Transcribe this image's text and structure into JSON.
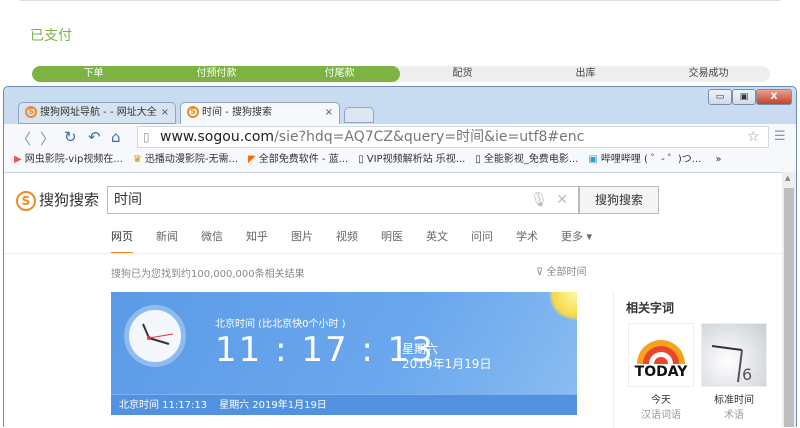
{
  "status": "已支付",
  "steps": [
    {
      "label": "下单",
      "done": true
    },
    {
      "label": "付预付款",
      "done": true
    },
    {
      "label": "付尾款",
      "done": true
    },
    {
      "label": "配货",
      "done": false
    },
    {
      "label": "出库",
      "done": false
    },
    {
      "label": "交易成功",
      "done": false
    }
  ],
  "window": {
    "minimize": "▭",
    "maximize": "▣",
    "close": "X"
  },
  "tabs": [
    {
      "title": "搜狗网址导航 - - 网址大全",
      "close": "×"
    },
    {
      "title": "时间 - 搜狗搜索",
      "close": "×"
    }
  ],
  "toolbar": {
    "back": "〈",
    "forward": "〉",
    "reload": "↻",
    "undo": "↶",
    "home": "⌂",
    "url_host": "www.sogou.com",
    "url_rest": "/sie?hdq=AQ7CZ&query=时间&ie=utf8#enc",
    "star": "☆",
    "menu": "☰"
  },
  "bookmarks": [
    {
      "icon": "▶",
      "label": "网虫影院-vip视频在..."
    },
    {
      "icon": "♛",
      "label": "迅播动漫影院-无需..."
    },
    {
      "icon": "◤",
      "label": "全部免费软件 - 蓝..."
    },
    {
      "icon": "▯",
      "label": "VIP视频解析站 乐视..."
    },
    {
      "icon": "▯",
      "label": "全能影视_免费电影..."
    },
    {
      "icon": "▣",
      "label": "哔哩哔哩 ( ゜- ゜)つ..."
    }
  ],
  "bookmarks_more": "»",
  "search": {
    "logo": "搜狗搜索",
    "query": "时间",
    "button": "搜狗搜索"
  },
  "verticals": [
    "网页",
    "新闻",
    "微信",
    "知乎",
    "图片",
    "视频",
    "明医",
    "英文",
    "问问",
    "学术",
    "更多 ▾"
  ],
  "result_count": "搜狗已为您找到约100,000,000条相关结果",
  "time_filter": "全部时间",
  "clock_card": {
    "label": "北京时间 (比北京快0个小时 )",
    "time": "11 : 17 : 13",
    "weekday": "星期六",
    "date": "2019年1月19日",
    "footer": [
      "北京时间  11:17:13",
      "星期六  2019年1月19日"
    ]
  },
  "related": {
    "title": "相关字词",
    "items": [
      {
        "name": "今天",
        "type": "汉语词语",
        "img_text": "TODAY"
      },
      {
        "name": "标准时间",
        "type": "术语"
      }
    ]
  }
}
